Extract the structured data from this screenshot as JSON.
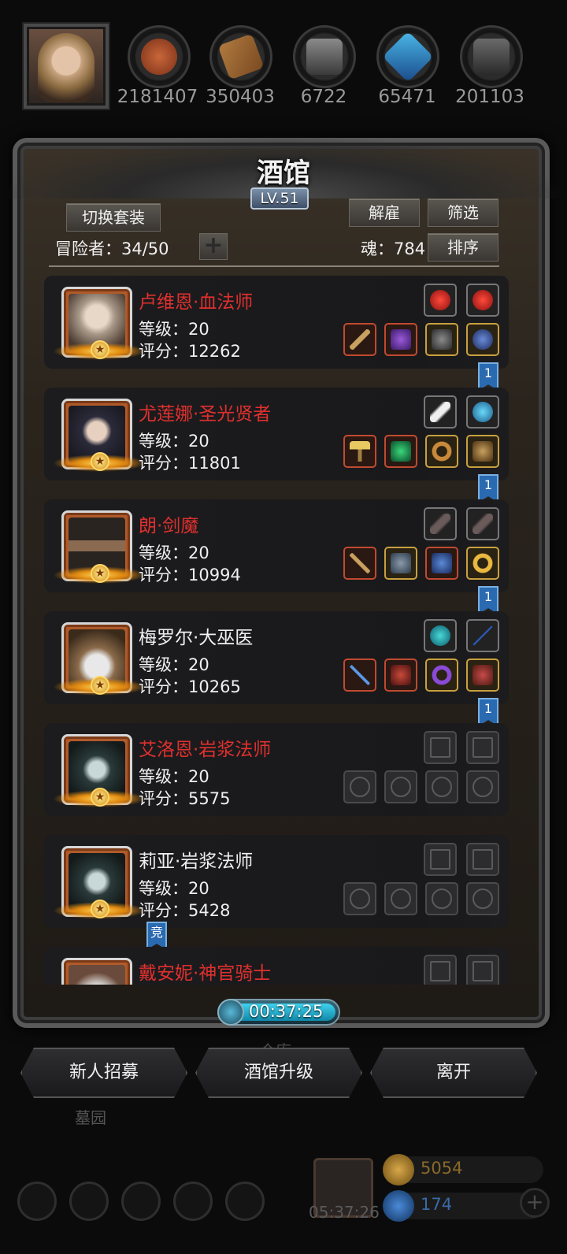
{
  "resources": [
    {
      "icon": "meat-icon",
      "value": "2181407"
    },
    {
      "icon": "wood-icon",
      "value": "350403"
    },
    {
      "icon": "iron-icon",
      "value": "6722"
    },
    {
      "icon": "crystal-icon",
      "value": "65471"
    },
    {
      "icon": "stone-icon",
      "value": "201103"
    }
  ],
  "panel": {
    "title": "酒馆",
    "level": "LV.51",
    "switch_set_label": "切换套装",
    "dismiss_label": "解雇",
    "filter_label": "筛选",
    "sort_label": "排序",
    "adventurers_label": "冒险者：34/50",
    "soul_label": "魂：784"
  },
  "heroes": [
    {
      "name": "卢维恩·血法师",
      "level": "等级：20",
      "score": "评分：12262",
      "name_color": "red"
    },
    {
      "name": "尤莲娜·圣光贤者",
      "level": "等级：20",
      "score": "评分：11801",
      "name_color": "red"
    },
    {
      "name": "朗·剑魔",
      "level": "等级：20",
      "score": "评分：10994",
      "name_color": "red"
    },
    {
      "name": "梅罗尔·大巫医",
      "level": "等级：20",
      "score": "评分：10265",
      "name_color": "white"
    },
    {
      "name": "艾洛恩·岩浆法师",
      "level": "等级：20",
      "score": "评分：5575",
      "name_color": "red"
    },
    {
      "name": "莉亚·岩浆法师",
      "level": "等级：20",
      "score": "评分：5428",
      "name_color": "white"
    },
    {
      "name": "戴安妮·神官骑士",
      "level": "",
      "score": "",
      "name_color": "red"
    }
  ],
  "bookmarks": [
    "1",
    "1",
    "1",
    "1",
    "竞"
  ],
  "timer": "00:37:25",
  "bottom_buttons": {
    "recruit": "新人招募",
    "upgrade": "酒馆升级",
    "leave": "离开"
  },
  "background": {
    "warehouse": "仓库",
    "cemetery": "墓园",
    "gift_timer": "05:37:26",
    "gold": "5054",
    "gems": "174"
  },
  "colors": {
    "accent_red": "#e0302e",
    "panel_brown": "#2a241d",
    "timer_cyan": "#3ed2ee"
  }
}
